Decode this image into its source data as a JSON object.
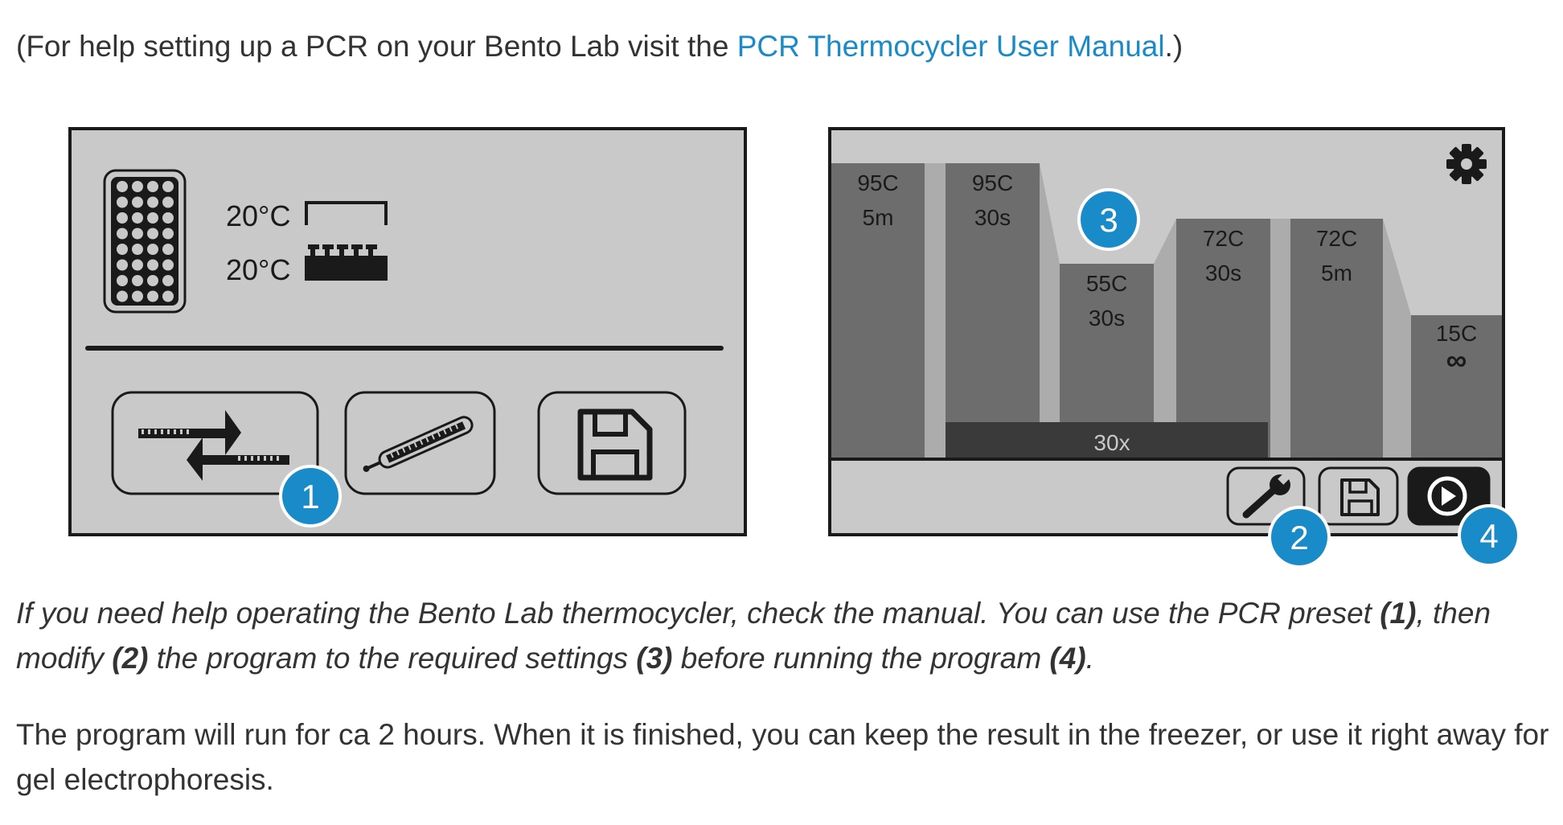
{
  "intro": {
    "before": "(For help setting up a PCR on your Bento Lab visit the ",
    "link": "PCR Thermocycler User Manual",
    "after": ".)"
  },
  "left_screen": {
    "temp_lid": "20°C",
    "temp_block": "20°C",
    "buttons": [
      "swap-arrows-icon",
      "pipette-icon",
      "save-icon"
    ],
    "callout": "1"
  },
  "right_screen": {
    "steps": [
      {
        "temp": "95C",
        "time": "5m"
      },
      {
        "temp": "95C",
        "time": "30s"
      },
      {
        "temp": "55C",
        "time": "30s"
      },
      {
        "temp": "72C",
        "time": "30s"
      },
      {
        "temp": "72C",
        "time": "5m"
      },
      {
        "temp": "15C",
        "time": "∞"
      }
    ],
    "cycles": "30x",
    "callouts": [
      "2",
      "3",
      "4"
    ],
    "buttons": [
      "wrench-icon",
      "save-icon",
      "play-icon"
    ],
    "settings_icon": "gear-icon"
  },
  "caption": {
    "p1": "If you need help operating the Bento Lab thermocycler, check the manual. You can use the PCR  preset ",
    "b1": "(1)",
    "p2": ", then modify ",
    "b2": "(2)",
    "p3": " the program to the required settings ",
    "b3": "(3)",
    "p4": " before running the program ",
    "b4": "(4)",
    "p5": "."
  },
  "body_text": "The program will run for ca 2 hours. When it is finished, you can keep the result in the freezer, or use it right away for gel electrophoresis.",
  "colors": {
    "link": "#1a8bc9",
    "callout": "#1a8bc9",
    "screen_bg": "#c9c9c9",
    "bar": "#6d6d6d",
    "cycle_band": "#3a3a3a"
  }
}
